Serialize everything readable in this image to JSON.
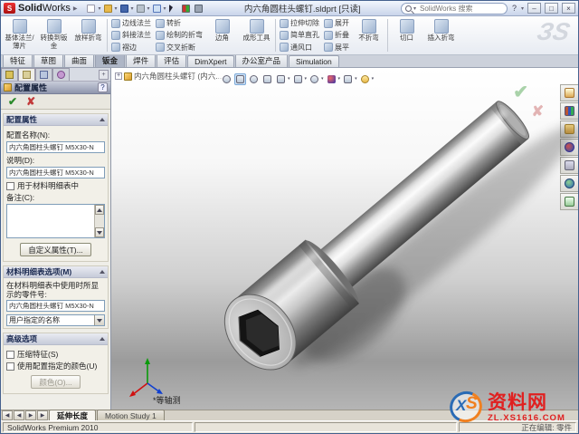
{
  "window": {
    "app_name_bold": "Solid",
    "app_name_light": "Works",
    "doc_title": "内六角圆柱头螺钉.sldprt [只读]",
    "search_placeholder": "SolidWorks 搜索",
    "help_label": "?",
    "minimize_label": "–",
    "maximize_label": "□",
    "close_label": "×"
  },
  "ribbon": {
    "large_buttons": [
      {
        "label": "基体法兰/薄片"
      },
      {
        "label": "转换到钣金"
      },
      {
        "label": "放样折弯"
      }
    ],
    "small_col_1": [
      "边线法兰",
      "斜接法兰",
      "褶边"
    ],
    "small_col_2": [
      "转折",
      "绘制的折弯",
      "交叉折断"
    ],
    "corner_button": "边角",
    "forming_button": "成形工具",
    "small_col_3": [
      "拉伸切除",
      "简单直孔",
      "通风口"
    ],
    "small_col_4": [
      "展开",
      "折叠",
      "展平"
    ],
    "large_buttons_2": [
      "不折弯",
      "切口",
      "插入折弯"
    ],
    "brand_mark": "ЗS"
  },
  "command_tabs": {
    "items": [
      "特征",
      "草图",
      "曲面",
      "钣金",
      "焊件",
      "评估",
      "DimXpert",
      "办公室产品",
      "Simulation"
    ],
    "active": "钣金"
  },
  "property_manager": {
    "title": "配置属性",
    "help": "?",
    "ok": "✔",
    "cancel": "✘",
    "config_group": {
      "header": "配置属性",
      "name_label": "配置名称(N):",
      "name_value": "内六角圆柱头螺钉 M5X30-N",
      "desc_label": "说明(D):",
      "desc_value": "内六角圆柱头螺钉 M5X30-N",
      "bom_checkbox": "用于材料明细表中",
      "comment_label": "备注(C):",
      "comment_value": "",
      "custom_props_button": "自定义属性(T)..."
    },
    "bom_group": {
      "header": "材料明细表选项(M)",
      "part_number_label": "在材料明细表中使用时所显示的零件号:",
      "part_number_value": "内六角圆柱头螺钉 M5X30-N",
      "name_source_value": "用户指定的名称"
    },
    "advanced_group": {
      "header": "高级选项",
      "suppress_checkbox": "压缩特征(S)",
      "color_checkbox": "使用配置指定的颜色(U)",
      "color_button": "颜色(O)..."
    }
  },
  "graphics": {
    "flyout_tree_label": "内六角圆柱头螺钉 (内六...",
    "view_orientation_label": "*等轴测"
  },
  "bottom_bar": {
    "model_tab": "延伸长度",
    "motion_tab": "Motion Study 1",
    "nav_first": "◀",
    "nav_prev": "◀",
    "nav_next": "▶",
    "nav_last": "▶"
  },
  "status_bar": {
    "left": "SolidWorks Premium 2010",
    "right": "正在编辑: 零件"
  },
  "watermark": {
    "logo_x": "X",
    "logo_s": "S",
    "site_name": "资料网",
    "url": "ZL.XS1616.COM"
  },
  "colors": {
    "titlebar_gradient_top": "#f2f6fd",
    "brand_red": "#e02020",
    "accent_blue": "#2a6bb5",
    "accent_orange": "#f08020",
    "ok_green": "#2c8a2c",
    "cancel_red": "#c23a3a"
  }
}
